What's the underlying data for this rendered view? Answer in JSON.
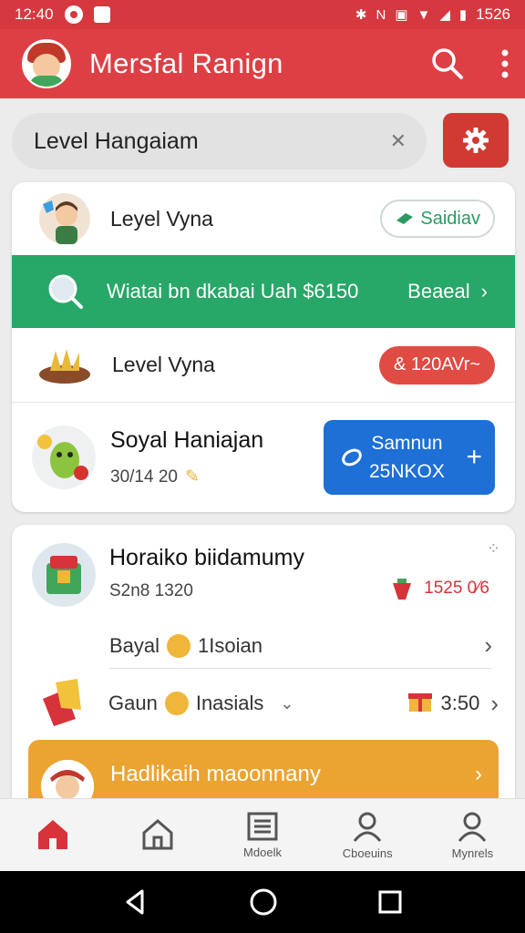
{
  "status_bar": {
    "time": "12:40",
    "battery": "1526",
    "signal_text": "N"
  },
  "app_bar": {
    "title": "Mersfal Ranign",
    "search_icon": "search-icon",
    "more_icon": "more-vert-icon"
  },
  "search": {
    "value": "Level Hangaiam",
    "placeholder": ""
  },
  "list": {
    "row1": {
      "label": "Leyel Vyna",
      "badge": "Saidiav"
    },
    "promo": {
      "text": "Wiatai bn dkabai Uah $6150",
      "link": "Beaeal"
    },
    "row3": {
      "label": "Level Vyna",
      "badge": "& 120AVr~"
    },
    "row4": {
      "title": "Soyal Haniajan",
      "subtitle": "30/14 20",
      "button_line1": "Samnun",
      "button_line2": "25NKOX"
    }
  },
  "card2": {
    "title": "Horaiko biidamumy",
    "subtitle": "S2n8 1320",
    "price": "1525 0⁄6",
    "row2_left": "Bayal",
    "row2_right": "1Isoian",
    "row3_left": "Gaun",
    "row3_right": "Inasials",
    "row3_value": "3:50"
  },
  "banner": {
    "text": "Hadlikaih maoonnany"
  },
  "bottom_nav": [
    {
      "icon": "home-filled-icon",
      "label": ""
    },
    {
      "icon": "home-outline-icon",
      "label": ""
    },
    {
      "icon": "list-icon",
      "label": "Mdoelk"
    },
    {
      "icon": "person-icon",
      "label": "Cboeuins"
    },
    {
      "icon": "person-icon",
      "label": "Mynrels"
    }
  ],
  "colors": {
    "accent": "#dd3f45",
    "green": "#27a768",
    "blue": "#1e6fd6",
    "orange": "#eba332"
  }
}
